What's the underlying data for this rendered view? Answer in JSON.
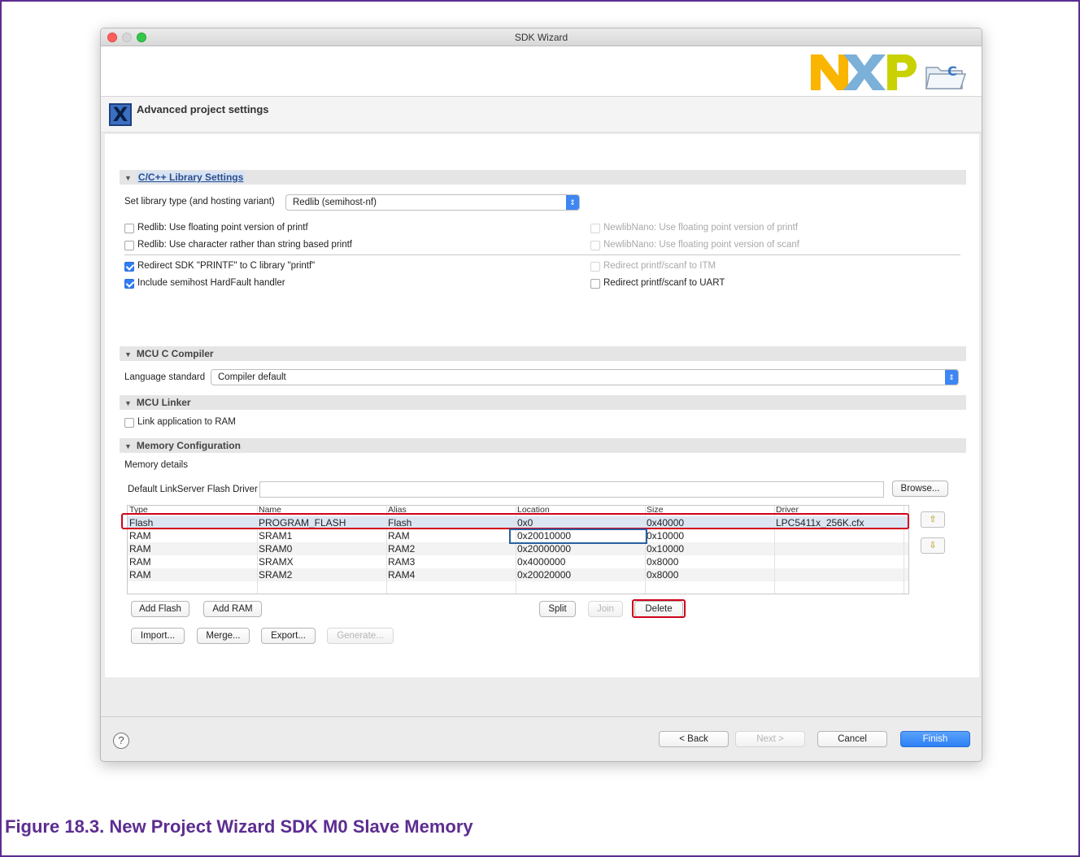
{
  "window": {
    "title": "SDK Wizard"
  },
  "header": {
    "title": "Advanced project settings",
    "icon": "x-icon"
  },
  "library": {
    "section": "C/C++ Library Settings",
    "type_label": "Set library type (and hosting variant)",
    "type_value": "Redlib (semihost-nf)",
    "checkboxes": {
      "redlib_fp_printf": "Redlib: Use floating point version of printf",
      "redlib_char_printf": "Redlib: Use character rather than string based printf",
      "redirect_sdk_printf": "Redirect SDK \"PRINTF\" to C library \"printf\"",
      "semihost_hardfault": "Include semihost HardFault handler",
      "newlibnano_fp_printf": "NewlibNano: Use floating point version of printf",
      "newlibnano_fp_scanf": "NewlibNano: Use floating point version of scanf",
      "redirect_itm": "Redirect printf/scanf to ITM",
      "redirect_uart": "Redirect printf/scanf to UART"
    },
    "checked": {
      "redlib_fp_printf": false,
      "redlib_char_printf": false,
      "redirect_sdk_printf": true,
      "semihost_hardfault": true,
      "newlibnano_fp_printf": false,
      "newlibnano_fp_scanf": false,
      "redirect_itm": false,
      "redirect_uart": false
    }
  },
  "compiler": {
    "section": "MCU C Compiler",
    "lang_label": "Language standard",
    "lang_value": "Compiler default"
  },
  "linker": {
    "section": "MCU Linker",
    "link_ram_label": "Link application to RAM"
  },
  "memory": {
    "section": "Memory Configuration",
    "details_label": "Memory details",
    "flash_driver_label": "Default LinkServer Flash Driver",
    "flash_driver_value": "",
    "browse": "Browse...",
    "columns": [
      "Type",
      "Name",
      "Alias",
      "Location",
      "Size",
      "Driver"
    ],
    "rows": [
      {
        "type": "Flash",
        "name": "PROGRAM_FLASH",
        "alias": "Flash",
        "location": "0x0",
        "size": "0x40000",
        "driver": "LPC5411x_256K.cfx"
      },
      {
        "type": "RAM",
        "name": "SRAM1",
        "alias": "RAM",
        "location": "0x20010000",
        "size": "0x10000",
        "driver": ""
      },
      {
        "type": "RAM",
        "name": "SRAM0",
        "alias": "RAM2",
        "location": "0x20000000",
        "size": "0x10000",
        "driver": ""
      },
      {
        "type": "RAM",
        "name": "SRAMX",
        "alias": "RAM3",
        "location": "0x4000000",
        "size": "0x8000",
        "driver": ""
      },
      {
        "type": "RAM",
        "name": "SRAM2",
        "alias": "RAM4",
        "location": "0x20020000",
        "size": "0x8000",
        "driver": ""
      }
    ],
    "buttons": {
      "add_flash": "Add Flash",
      "add_ram": "Add RAM",
      "split": "Split",
      "join": "Join",
      "delete": "Delete",
      "import": "Import...",
      "merge": "Merge...",
      "export": "Export...",
      "generate": "Generate..."
    }
  },
  "footer": {
    "help": "?",
    "back": "< Back",
    "next": "Next >",
    "cancel": "Cancel",
    "finish": "Finish"
  },
  "caption": "Figure 18.3. New Project Wizard SDK M0 Slave Memory",
  "colors": {
    "accent": "#2d7ff5",
    "highlight": "#d0021b",
    "caption": "#5c2d91",
    "nxp_yellow": "#f9b500",
    "nxp_green": "#c9d200"
  }
}
